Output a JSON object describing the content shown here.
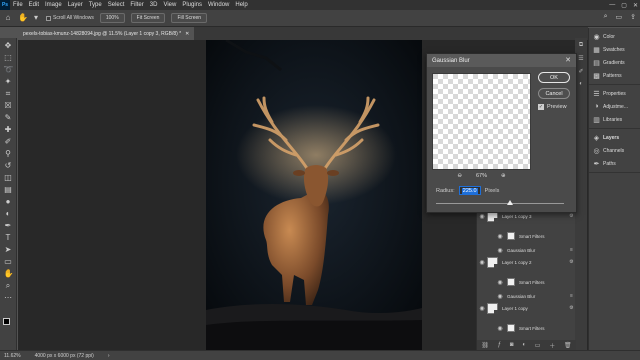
{
  "menubar": {
    "logo": "Ps",
    "items": [
      "File",
      "Edit",
      "Image",
      "Layer",
      "Type",
      "Select",
      "Filter",
      "3D",
      "View",
      "Plugins",
      "Window",
      "Help"
    ]
  },
  "optionsbar": {
    "scroll_all_windows": "Scroll All Windows",
    "zoom_btn": "100%",
    "fit_btn": "Fit Screen",
    "fill_btn": "Fill Screen"
  },
  "document": {
    "tab_title": "pexels-tobias-kmunz-14828094.jpg @ 11.5% (Layer 1 copy 3, RGB/8) *"
  },
  "status": {
    "zoom": "11.62%",
    "doc_size": "4000 px x 6000 px (72 ppi)"
  },
  "panels": {
    "group1": [
      "Color",
      "Swatches",
      "Gradients",
      "Patterns"
    ],
    "group2": [
      "Properties",
      "Adjustme...",
      "Libraries"
    ],
    "group3": [
      "Layers",
      "Channels",
      "Paths"
    ]
  },
  "layers": {
    "rows": [
      {
        "name": "Layer 1 copy 3",
        "kind": "layer"
      },
      {
        "name": "Smart Filters",
        "kind": "filters"
      },
      {
        "name": "Gaussian Blur",
        "kind": "effect"
      },
      {
        "name": "Layer 1 copy 2",
        "kind": "layer"
      },
      {
        "name": "Smart Filters",
        "kind": "filters"
      },
      {
        "name": "Gaussian Blur",
        "kind": "effect"
      },
      {
        "name": "Layer 1 copy",
        "kind": "layer"
      },
      {
        "name": "Smart Filters",
        "kind": "filters"
      }
    ]
  },
  "dialog": {
    "title": "Gaussian Blur",
    "ok": "OK",
    "cancel": "Cancel",
    "preview_label": "Preview",
    "zoom_level": "67%",
    "radius_label": "Radius:",
    "radius_value": "225.0",
    "radius_unit": "Pixels",
    "radius_slider_fraction": 0.58
  },
  "colors": {
    "ps_blue": "#31a8ff",
    "highlight": "#1e6fd9"
  }
}
